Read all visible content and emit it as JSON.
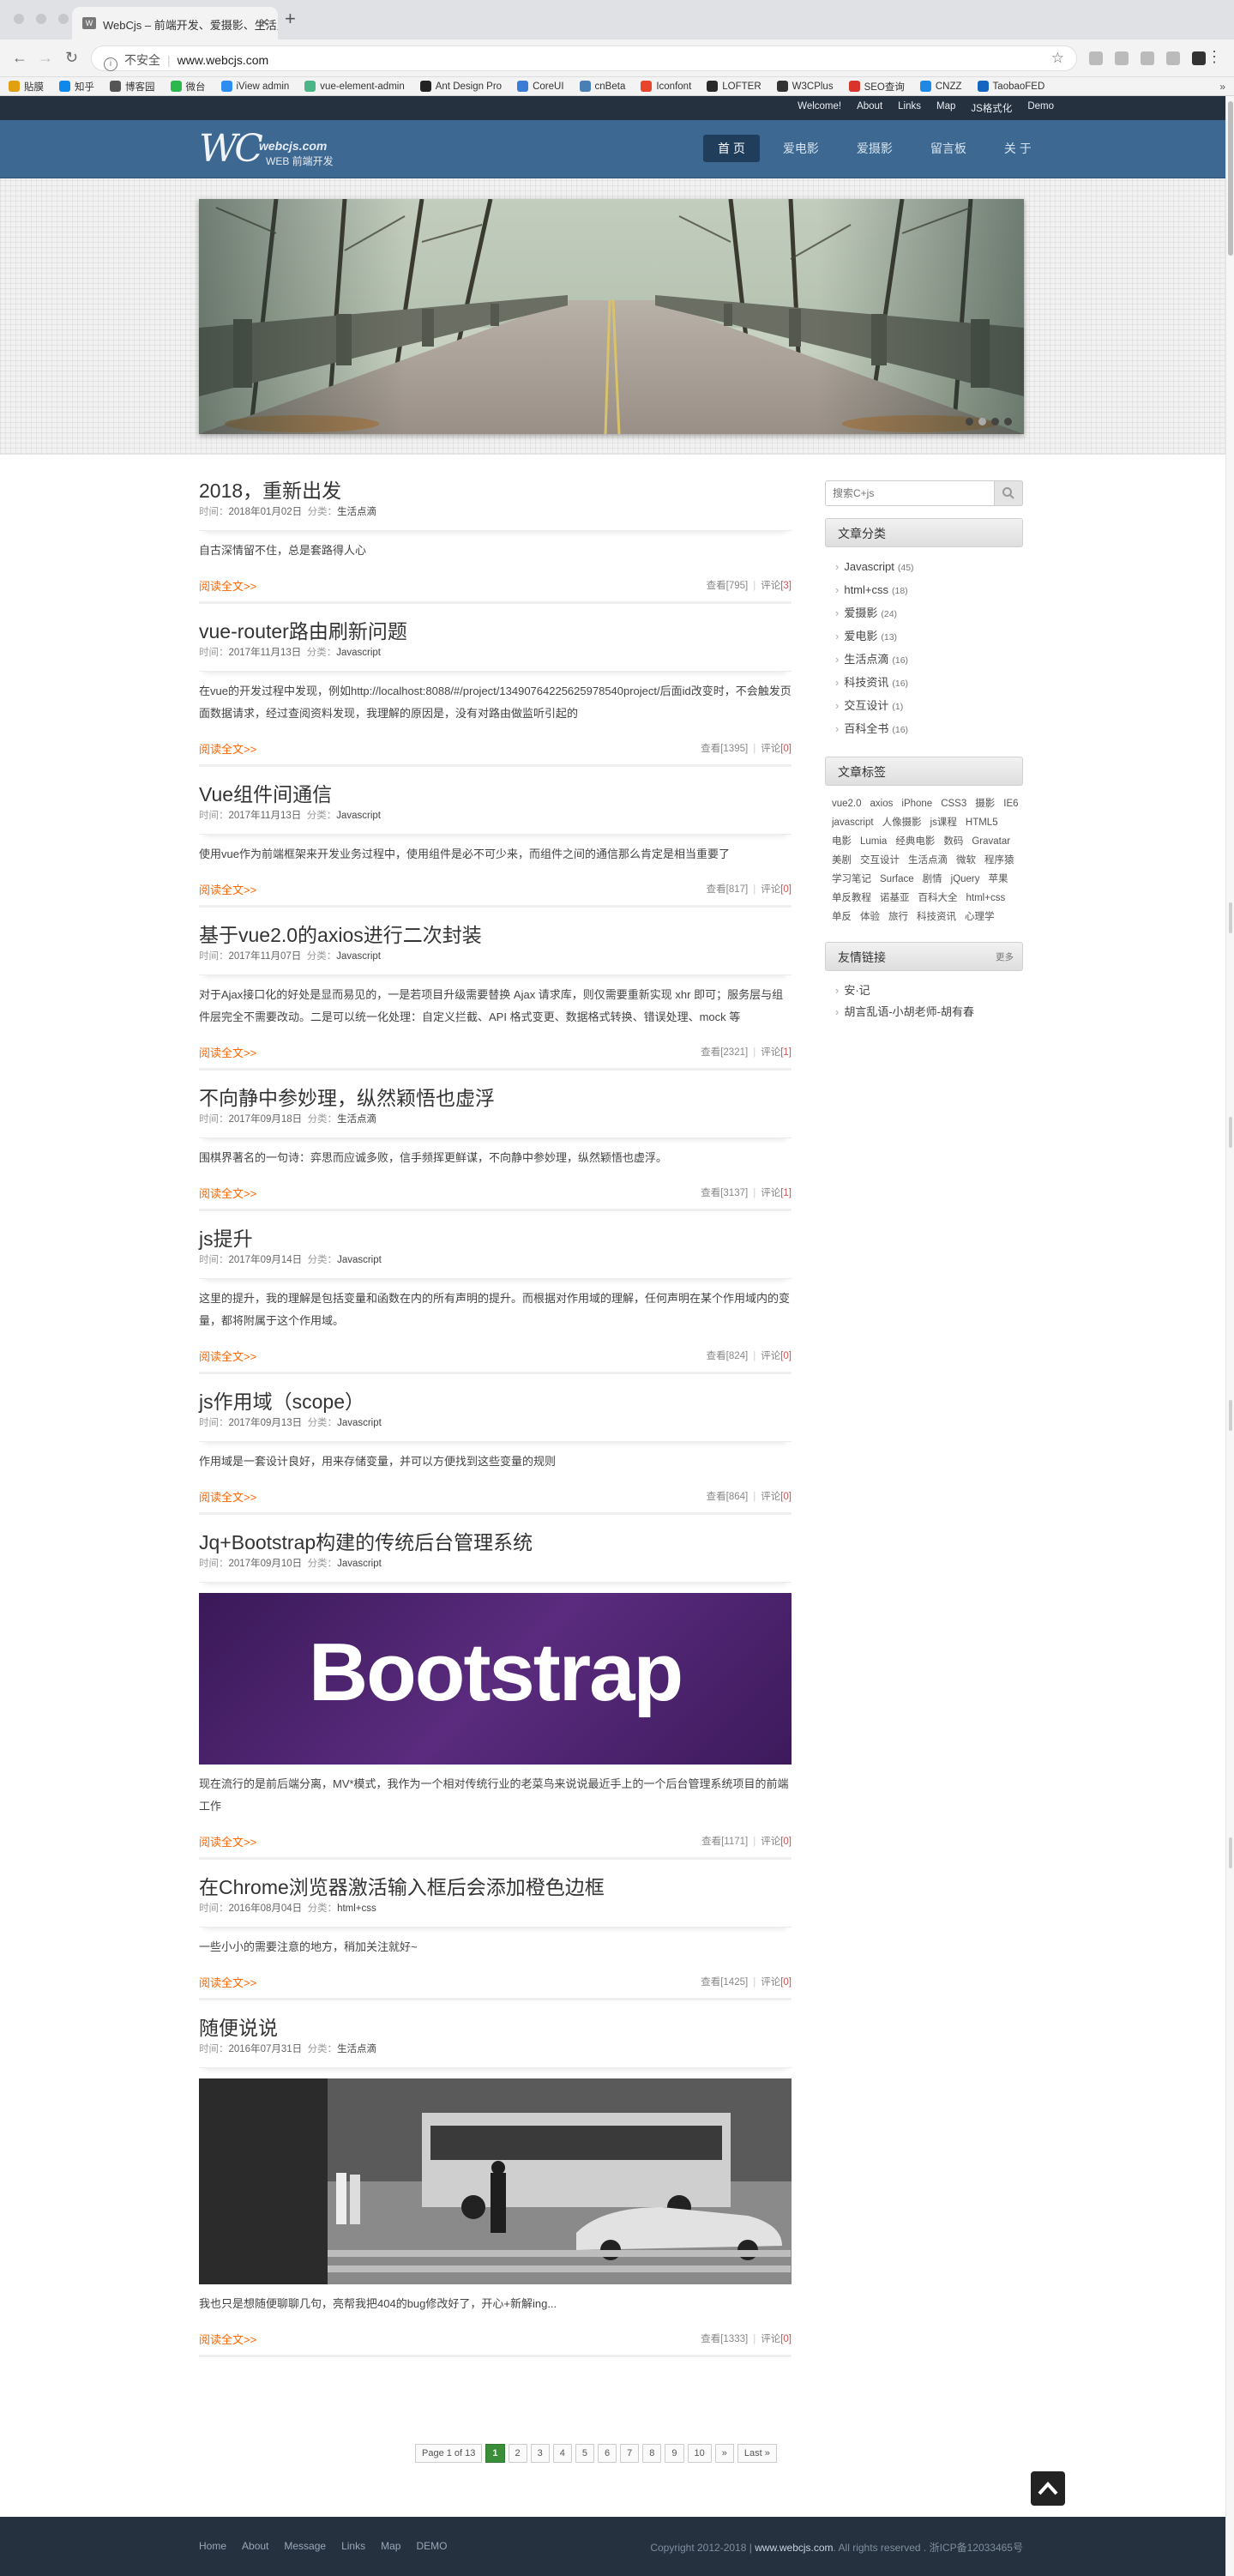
{
  "browser": {
    "tab_title": "WebCjs – 前端开发、爱摄影、生活点滴",
    "tab_favicon": "W",
    "url_insecure": "不安全",
    "url": "www.webcjs.com",
    "bookmarks": [
      {
        "label": "貼膜",
        "color": "#e0a010"
      },
      {
        "label": "知乎",
        "color": "#0f88eb"
      },
      {
        "label": "博客园",
        "color": "#555555"
      },
      {
        "label": "微台",
        "color": "#2db84d"
      },
      {
        "label": "iView admin",
        "color": "#2d8cf0"
      },
      {
        "label": "vue-element-admin",
        "color": "#4bb587"
      },
      {
        "label": "Ant Design Pro",
        "color": "#222222"
      },
      {
        "label": "CoreUI",
        "color": "#3a7bd5"
      },
      {
        "label": "cnBeta",
        "color": "#4a7fb5"
      },
      {
        "label": "Iconfont",
        "color": "#e8452c"
      },
      {
        "label": "LOFTER",
        "color": "#2a2a2a"
      },
      {
        "label": "W3CPlus",
        "color": "#333333"
      },
      {
        "label": "SEO查询",
        "color": "#d9342b"
      },
      {
        "label": "CNZZ",
        "color": "#1e88e5"
      },
      {
        "label": "TaobaoFED",
        "color": "#1565c0"
      }
    ],
    "bookmarks_more": "»"
  },
  "site": {
    "top_links": [
      "Welcome!",
      "About",
      "Links",
      "Map",
      "JS格式化",
      "Demo"
    ],
    "logo_mark": "WC",
    "logo_domain": "webcjs.com",
    "logo_sub": "WEB 前端开发",
    "nav": [
      {
        "label": "首 页",
        "active": true
      },
      {
        "label": "爱电影",
        "active": false
      },
      {
        "label": "爱摄影",
        "active": false
      },
      {
        "label": "留言板",
        "active": false
      },
      {
        "label": "关 于",
        "active": false
      }
    ]
  },
  "posts": [
    {
      "title": "2018，重新出发",
      "time_label": "时间：",
      "date": "2018年01月02日",
      "cat_label": "分类：",
      "category": "生活点滴",
      "summary": "自古深情留不住，总是套路得人心",
      "image": "",
      "read_more": "阅读全文>>",
      "views_label": "查看",
      "views": "[795]",
      "comments_label": "评论",
      "comments": "[3]"
    },
    {
      "title": "vue-router路由刷新问题",
      "time_label": "时间：",
      "date": "2017年11月13日",
      "cat_label": "分类：",
      "category": "Javascript",
      "summary": "在vue的开发过程中发现，例如http://localhost:8088/#/project/13490764225625978540project/后面id改变时，不会触发页面数据请求，经过查阅资料发现，我理解的原因是，没有对路由做监听引起的",
      "image": "",
      "read_more": "阅读全文>>",
      "views_label": "查看",
      "views": "[1395]",
      "comments_label": "评论",
      "comments": "[0]"
    },
    {
      "title": "Vue组件间通信",
      "time_label": "时间：",
      "date": "2017年11月13日",
      "cat_label": "分类：",
      "category": "Javascript",
      "summary": "使用vue作为前端框架来开发业务过程中，使用组件是必不可少来，而组件之间的通信那么肯定是相当重要了",
      "image": "",
      "read_more": "阅读全文>>",
      "views_label": "查看",
      "views": "[817]",
      "comments_label": "评论",
      "comments": "[0]"
    },
    {
      "title": "基于vue2.0的axios进行二次封装",
      "time_label": "时间：",
      "date": "2017年11月07日",
      "cat_label": "分类：",
      "category": "Javascript",
      "summary": "对于Ajax接口化的好处是显而易见的，一是若项目升级需要替换 Ajax 请求库，则仅需要重新实现 xhr 即可；服务层与组件层完全不需要改动。二是可以统一化处理：自定义拦截、API 格式变更、数据格式转换、错误处理、mock 等",
      "image": "",
      "read_more": "阅读全文>>",
      "views_label": "查看",
      "views": "[2321]",
      "comments_label": "评论",
      "comments": "[1]"
    },
    {
      "title": "不向静中参妙理，纵然颖悟也虚浮",
      "time_label": "时间：",
      "date": "2017年09月18日",
      "cat_label": "分类：",
      "category": "生活点滴",
      "summary": "围棋界著名的一句诗：弈思而应诚多败，信手频挥更鲜谋，不向静中参妙理，纵然颖悟也虚浮。",
      "image": "",
      "read_more": "阅读全文>>",
      "views_label": "查看",
      "views": "[3137]",
      "comments_label": "评论",
      "comments": "[1]"
    },
    {
      "title": "js提升",
      "time_label": "时间：",
      "date": "2017年09月14日",
      "cat_label": "分类：",
      "category": "Javascript",
      "summary": "这里的提升，我的理解是包括变量和函数在内的所有声明的提升。而根据对作用域的理解，任何声明在某个作用域内的变量，都将附属于这个作用域。",
      "image": "",
      "read_more": "阅读全文>>",
      "views_label": "查看",
      "views": "[824]",
      "comments_label": "评论",
      "comments": "[0]"
    },
    {
      "title": "js作用域（scope）",
      "time_label": "时间：",
      "date": "2017年09月13日",
      "cat_label": "分类：",
      "category": "Javascript",
      "summary": "作用域是一套设计良好，用来存储变量，并可以方便找到这些变量的规则",
      "image": "",
      "read_more": "阅读全文>>",
      "views_label": "查看",
      "views": "[864]",
      "comments_label": "评论",
      "comments": "[0]"
    },
    {
      "title": "Jq+Bootstrap构建的传统后台管理系统",
      "time_label": "时间：",
      "date": "2017年09月10日",
      "cat_label": "分类：",
      "category": "Javascript",
      "summary": "现在流行的是前后端分离，MV*模式，我作为一个相对传统行业的老菜鸟来说说最近手上的一个后台管理系统项目的前端工作",
      "image": "bootstrap",
      "image_text": "Bootstrap",
      "read_more": "阅读全文>>",
      "views_label": "查看",
      "views": "[1171]",
      "comments_label": "评论",
      "comments": "[0]"
    },
    {
      "title": "在Chrome浏览器激活输入框后会添加橙色边框",
      "time_label": "时间：",
      "date": "2016年08月04日",
      "cat_label": "分类：",
      "category": "html+css",
      "summary": "一些小小的需要注意的地方，稍加关注就好~",
      "image": "",
      "read_more": "阅读全文>>",
      "views_label": "查看",
      "views": "[1425]",
      "comments_label": "评论",
      "comments": "[0]"
    },
    {
      "title": "随便说说",
      "time_label": "时间：",
      "date": "2016年07月31日",
      "cat_label": "分类：",
      "category": "生活点滴",
      "summary": "我也只是想随便聊聊几句，亮帮我把404的bug修改好了，开心+新解ing...",
      "image": "street",
      "read_more": "阅读全文>>",
      "views_label": "查看",
      "views": "[1333]",
      "comments_label": "评论",
      "comments": "[0]"
    }
  ],
  "pagination": {
    "summary": "Page 1 of 13",
    "pages": [
      "1",
      "2",
      "3",
      "4",
      "5",
      "6",
      "7",
      "8",
      "9",
      "10"
    ],
    "current": "1",
    "next": "»",
    "last": "Last »"
  },
  "sidebar": {
    "search_placeholder": "搜索C+js",
    "categories_title": "文章分类",
    "categories": [
      {
        "name": "Javascript",
        "count": "(45)"
      },
      {
        "name": "html+css",
        "count": "(18)"
      },
      {
        "name": "爱摄影",
        "count": "(24)"
      },
      {
        "name": "爱电影",
        "count": "(13)"
      },
      {
        "name": "生活点滴",
        "count": "(16)"
      },
      {
        "name": "科技资讯",
        "count": "(16)"
      },
      {
        "name": "交互设计",
        "count": "(1)"
      },
      {
        "name": "百科全书",
        "count": "(16)"
      }
    ],
    "tags_title": "文章标签",
    "tags": [
      "vue2.0",
      "axios",
      "iPhone",
      "CSS3",
      "摄影",
      "IE6",
      "javascript",
      "人像摄影",
      "js课程",
      "HTML5",
      "电影",
      "Lumia",
      "经典电影",
      "数码",
      "Gravatar",
      "美剧",
      "交互设计",
      "生活点滴",
      "微软",
      "程序猿",
      "学习笔记",
      "Surface",
      "剧情",
      "jQuery",
      "苹果",
      "单反教程",
      "诺基亚",
      "百科大全",
      "html+css",
      "单反",
      "体验",
      "旅行",
      "科技资讯",
      "心理学"
    ],
    "links_title": "友情链接",
    "links_more": "更多",
    "links": [
      "安·记",
      "胡言乱语-小胡老师-胡有春"
    ]
  },
  "footer": {
    "links": [
      "Home",
      "About",
      "Message",
      "Links",
      "Map",
      "DEMO"
    ],
    "copyright": "Copyright 2012-2018 |",
    "domain": "www.webcjs.com",
    "rights": ". All rights reserved . 浙ICP备12033465号"
  }
}
